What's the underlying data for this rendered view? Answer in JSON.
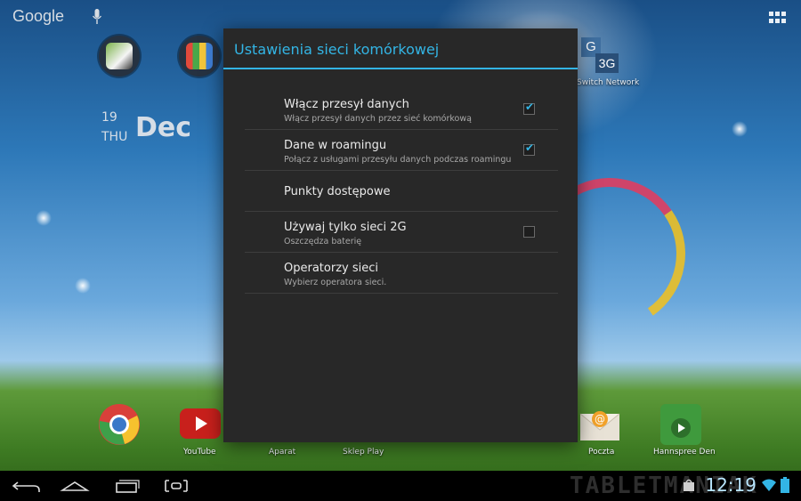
{
  "home": {
    "search_label": "Google",
    "date": {
      "day": "19",
      "weekday": "THU",
      "month": "Dec"
    },
    "switch_network_label": "Switch Network",
    "g3g_icon": {
      "top": "G",
      "bottom": "3G"
    },
    "dock": [
      {
        "label": ""
      },
      {
        "label": "YouTube"
      },
      {
        "label": "Aparat"
      },
      {
        "label": "Sklep Play"
      },
      {
        "label": "Poczta"
      },
      {
        "label": "Hannspree Den"
      }
    ]
  },
  "dialog": {
    "title": "Ustawienia sieci komórkowej",
    "items": [
      {
        "title": "Włącz przesył danych",
        "summary": "Włącz przesył danych przez sieć komórkową",
        "checked": true,
        "has_checkbox": true
      },
      {
        "title": "Dane w roamingu",
        "summary": "Połącz z usługami przesyłu danych podczas roamingu",
        "checked": true,
        "has_checkbox": true
      },
      {
        "title": "Punkty dostępowe",
        "summary": "",
        "checked": false,
        "has_checkbox": false
      },
      {
        "title": "Używaj tylko sieci 2G",
        "summary": "Oszczędza baterię",
        "checked": false,
        "has_checkbox": true
      },
      {
        "title": "Operatorzy sieci",
        "summary": "Wybierz operatora sieci.",
        "checked": false,
        "has_checkbox": false
      }
    ],
    "checkmark_glyph": "✔"
  },
  "status": {
    "time": "12:19",
    "watermark": "TABLETMANIAK"
  },
  "colors": {
    "accent": "#33b5e5",
    "dialog_bg": "#282828"
  }
}
